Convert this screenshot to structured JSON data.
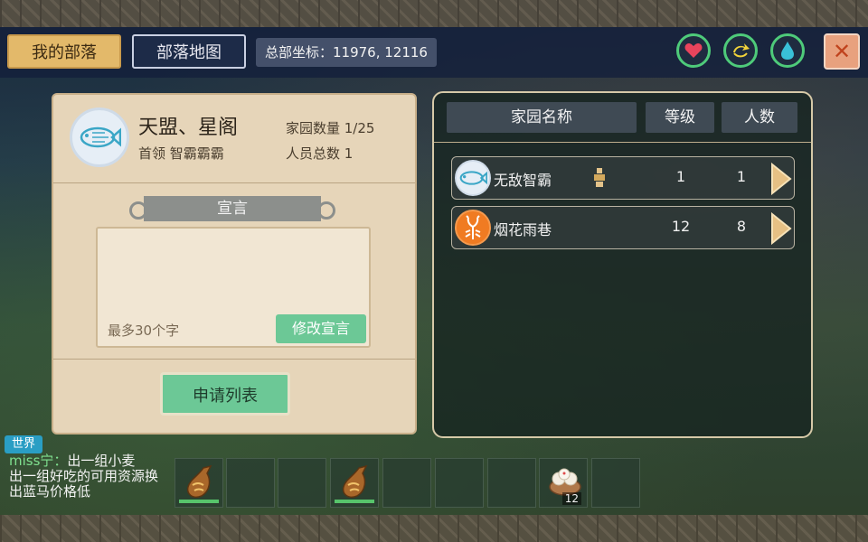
{
  "header": {
    "tab_my_tribe": "我的部落",
    "tab_tribe_map": "部落地图",
    "coords_label": "总部坐标：11976, 12116",
    "icons": [
      "heart-icon",
      "refresh-icon",
      "water-drop-icon"
    ],
    "close_symbol": "✕"
  },
  "tribe": {
    "name": "天盟、星阁",
    "leader": "首领 智霸霸霸",
    "home_count": "家园数量 1/25",
    "member_count": "人员总数 1",
    "avatar_icon": "fish-icon"
  },
  "declaration": {
    "title": "宣言",
    "placeholder": "最多30个字",
    "edit_label": "修改宣言"
  },
  "apply_list_label": "申请列表",
  "home_list": {
    "headers": [
      "家园名称",
      "等级",
      "人数"
    ],
    "rows": [
      {
        "name": "无敌智霸",
        "level": "1",
        "members": "1",
        "icon": "fish-icon",
        "leader": true
      },
      {
        "name": "烟花雨巷",
        "level": "12",
        "members": "8",
        "icon": "scorpion-icon",
        "leader": false
      }
    ]
  },
  "chat": {
    "channel": "世界",
    "sender": "miss宁：",
    "message": "出一组小麦\n出一组好吃的可用资源换   出蓝马价格低"
  },
  "hotbar": {
    "slots": [
      {
        "item": "seed-pouch-icon",
        "count": ""
      },
      {
        "item": "",
        "count": ""
      },
      {
        "item": "",
        "count": ""
      },
      {
        "item": "seed-pouch-icon",
        "count": ""
      },
      {
        "item": "",
        "count": ""
      },
      {
        "item": "",
        "count": ""
      },
      {
        "item": "",
        "count": ""
      },
      {
        "item": "steamed-bun-icon",
        "count": "12"
      },
      {
        "item": "",
        "count": ""
      }
    ]
  },
  "colors": {
    "accent_green": "#6cc896",
    "tab_active": "#e3b96a",
    "panel_beige": "#e6d5b9",
    "icon_ring": "#4ecb7a",
    "close_bg": "#e8a17e"
  }
}
